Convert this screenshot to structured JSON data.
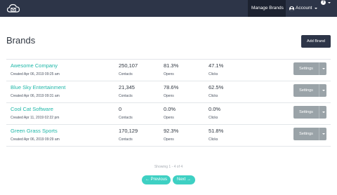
{
  "nav": {
    "manage_brands": "Manage Brands",
    "account": "Account",
    "help_glyph": "?"
  },
  "header": {
    "title": "Brands",
    "add_brand": "Add Brand"
  },
  "table": {
    "metric_labels": [
      "Contacts",
      "Opens",
      "Clicks"
    ],
    "settings_label": "Settings",
    "rows": [
      {
        "name": "Awesome Company",
        "created": "Created Apr 06, 2019 09:25 am",
        "contacts": "250,107",
        "opens": "81.3%",
        "clicks": "47.1%"
      },
      {
        "name": "Blue Sky Entertainment",
        "created": "Created Apr 06, 2019 09:31 am",
        "contacts": "21,345",
        "opens": "78.6%",
        "clicks": "62.5%"
      },
      {
        "name": "Cool Cat Software",
        "created": "Created Apr 11, 2019 02:22 pm",
        "contacts": "0",
        "opens": "0.0%",
        "clicks": "0.0%"
      },
      {
        "name": "Green Grass Sports",
        "created": "Created Apr 06, 2019 09:29 am",
        "contacts": "170,129",
        "opens": "92.3%",
        "clicks": "51.8%"
      }
    ]
  },
  "pagination": {
    "showing": "Showing 1 - 4 of 4",
    "previous": "← Previous",
    "next": "Next →"
  },
  "colors": {
    "nav_bg": "#2d3548",
    "nav_active_bg": "#1c2230",
    "brand_link": "#1fb7a8",
    "settings_button": "#9aa3a8",
    "pager_button": "#3ed0c3"
  },
  "icons": [
    "cloud-mail-logo-icon",
    "user-icon",
    "help-icon",
    "chevron-down-icon"
  ]
}
